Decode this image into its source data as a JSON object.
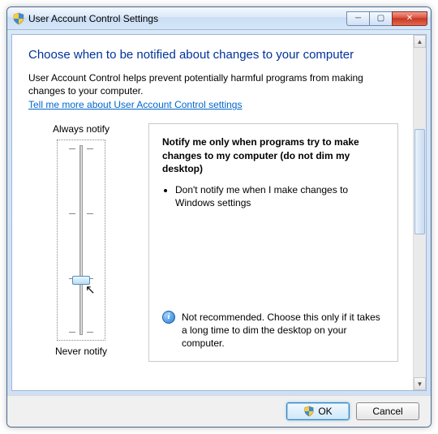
{
  "titlebar": {
    "title": "User Account Control Settings"
  },
  "heading": "Choose when to be notified about changes to your computer",
  "intro": "User Account Control helps prevent potentially harmful programs from making changes to your computer.",
  "help_link": "Tell me more about User Account Control settings",
  "slider": {
    "top_label": "Always notify",
    "bottom_label": "Never notify",
    "levels": 4,
    "current_level": 1
  },
  "description": {
    "title": "Notify me only when programs try to make changes to my computer (do not dim my desktop)",
    "bullets": [
      "Don't notify me when I make changes to Windows settings"
    ],
    "recommendation": "Not recommended. Choose this only if it takes a long time to dim the desktop on your computer."
  },
  "buttons": {
    "ok": "OK",
    "cancel": "Cancel"
  }
}
